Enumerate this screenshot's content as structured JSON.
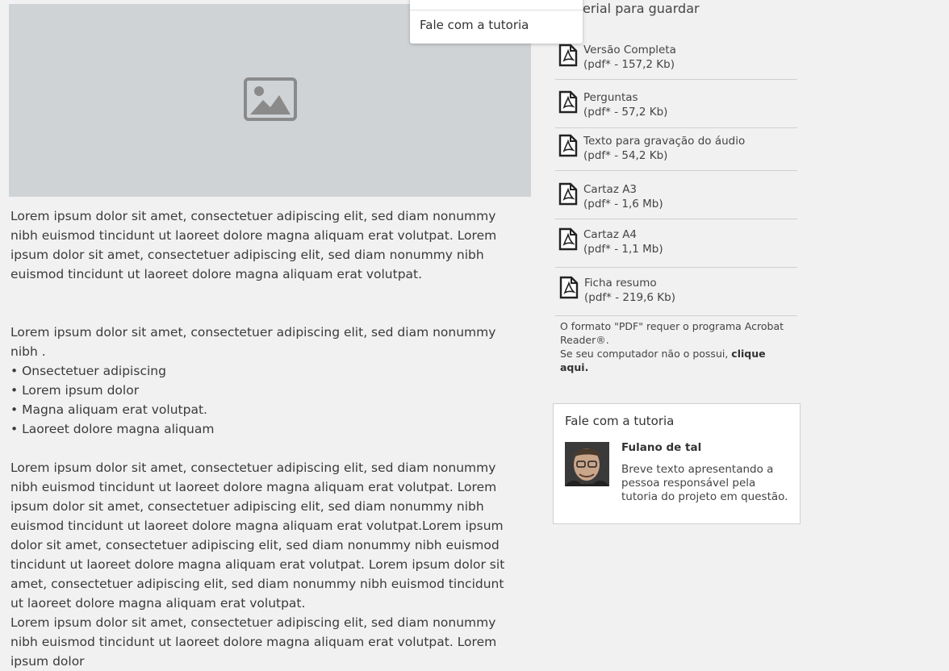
{
  "hero": {
    "icon": "image-placeholder-icon"
  },
  "dropdown": {
    "item_label": "Fale com a tutoria"
  },
  "sidebar": {
    "heading": "erial para guardar",
    "files": [
      {
        "icon": "pdf-file-icon",
        "name": "Versão Completa",
        "meta": "(pdf* - 157,2 Kb)"
      },
      {
        "icon": "pdf-file-icon",
        "name": "Perguntas",
        "meta": "(pdf* - 57,2 Kb)"
      },
      {
        "icon": "pdf-file-icon",
        "name": "Texto para gravação do áudio",
        "meta": "(pdf* - 54,2 Kb)"
      },
      {
        "icon": "pdf-file-icon",
        "name": "Cartaz A3",
        "meta": "(pdf* - 1,6 Mb)"
      },
      {
        "icon": "pdf-file-icon",
        "name": "Cartaz A4",
        "meta": "(pdf* - 1,1 Mb)"
      },
      {
        "icon": "pdf-file-icon",
        "name": "Ficha resumo",
        "meta": "(pdf* - 219,6 Kb)"
      }
    ],
    "note_line1": "O formato \"PDF\" requer o programa Acrobat Reader®.",
    "note_line2": "Se seu computador não o possui, ",
    "note_link": "clique aqui."
  },
  "tutor": {
    "title": "Fale com a tutoria",
    "name": "Fulano de tal",
    "description": "Breve texto apresentando a pessoa responsável pela tutoria do projeto em questão."
  },
  "article": {
    "p1": "Lorem ipsum dolor sit amet, consectetuer adipiscing elit, sed diam nonummy nibh euismod tincidunt ut laoreet dolore magna aliquam erat volutpat. Lorem ipsum dolor sit amet, consectetuer adipiscing elit, sed diam nonummy nibh euismod tincidunt ut laoreet dolore magna aliquam erat volutpat.",
    "p2": "Lorem ipsum dolor sit amet, consectetuer adipiscing elit, sed diam nonummy nibh .",
    "bullets": [
      "• Onsectetuer adipiscing",
      "• Lorem ipsum dolor",
      "• Magna aliquam erat volutpat.",
      "• Laoreet dolore magna aliquam"
    ],
    "p3": "Lorem ipsum dolor sit amet, consectetuer adipiscing elit, sed diam nonummy nibh euismod tincidunt ut laoreet dolore magna aliquam erat volutpat. Lorem ipsum dolor sit amet, consectetuer adipiscing elit, sed diam nonummy nibh euismod tincidunt ut laoreet dolore magna aliquam erat volutpat.Lorem ipsum dolor sit amet, consectetuer adipiscing elit, sed diam nonummy nibh euismod tincidunt ut laoreet dolore magna aliquam erat volutpat. Lorem ipsum dolor sit amet, consectetuer adipiscing elit, sed diam nonummy nibh euismod tincidunt ut laoreet dolore magna aliquam erat volutpat.",
    "p4": "Lorem ipsum dolor sit amet, consectetuer adipiscing elit, sed diam nonummy nibh euismod tincidunt ut laoreet dolore magna aliquam erat volutpat. Lorem ipsum dolor"
  }
}
